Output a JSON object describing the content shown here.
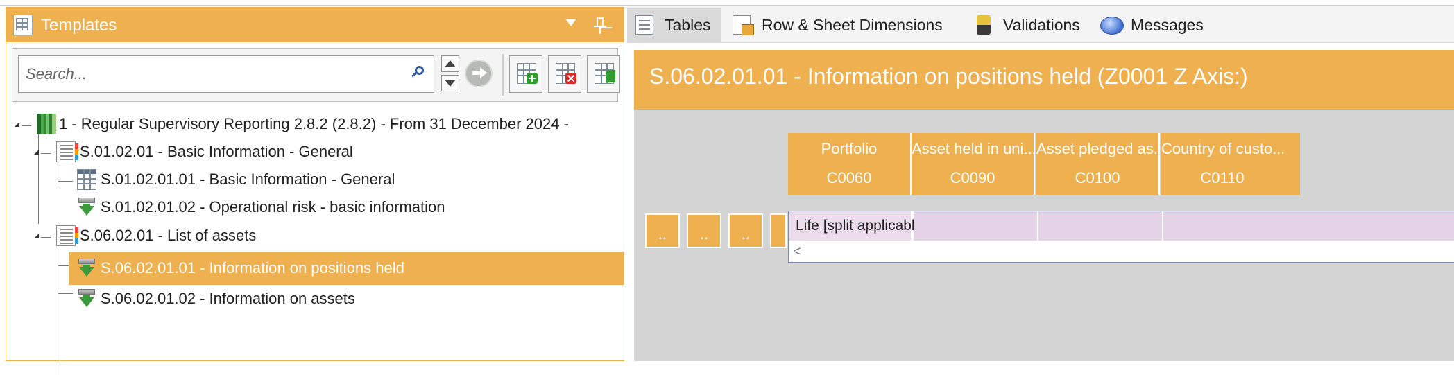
{
  "templates_panel": {
    "title": "Templates",
    "search": {
      "placeholder": "Search..."
    },
    "tree": [
      {
        "label": "1 - Regular Supervisory Reporting 2.8.2 (2.8.2) - From 31 December 2024 -",
        "icon": "book-icon",
        "level": 0
      },
      {
        "label": "S.01.02.01 - Basic Information - General",
        "icon": "list-icon",
        "level": 1
      },
      {
        "label": "S.01.02.01.01 - Basic Information - General",
        "icon": "table-icon",
        "level": 2
      },
      {
        "label": "S.01.02.01.02 - Operational risk - basic information",
        "icon": "open-table-icon",
        "level": 2
      },
      {
        "label": "S.06.02.01 - List of assets",
        "icon": "list-icon",
        "level": 1
      },
      {
        "label": "S.06.02.01.01 - Information on positions held",
        "icon": "open-table-icon",
        "level": 2,
        "selected": true
      },
      {
        "label": "S.06.02.01.02 - Information on assets",
        "icon": "open-table-icon",
        "level": 2
      }
    ]
  },
  "tabs": [
    {
      "label": "Tables",
      "icon": "tables-icon",
      "active": true
    },
    {
      "label": "Row & Sheet Dimensions",
      "icon": "dimensions-icon"
    },
    {
      "label": "Validations",
      "icon": "validations-icon"
    },
    {
      "label": "Messages",
      "icon": "messages-icon"
    }
  ],
  "table_view": {
    "title": "S.06.02.01.01 - Information on positions held (Z0001 Z Axis:)",
    "columns": [
      {
        "label": "Portfolio",
        "code": "C0060"
      },
      {
        "label": "Asset held in uni...",
        "code": "C0090"
      },
      {
        "label": "Asset pledged as...",
        "code": "C0100"
      },
      {
        "label": "Country of custo...",
        "code": "C0110"
      }
    ],
    "z_buttons": [
      "..",
      "..",
      "..",
      ".."
    ],
    "row": {
      "first_cell": "Life [split applicable]",
      "other_cells": [
        "",
        "",
        ""
      ]
    },
    "scroll_left": "<"
  },
  "colors": {
    "accent": "#efb04f",
    "cell_fill": "#e4d2e6",
    "content_bg": "#d4d4d4"
  }
}
